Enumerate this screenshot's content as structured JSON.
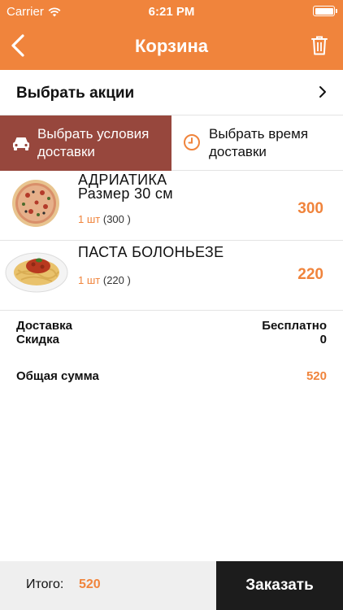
{
  "status_bar": {
    "carrier": "Carrier",
    "time": "6:21 PM"
  },
  "nav": {
    "title": "Корзина",
    "back_icon": "chevron-left-icon",
    "trash_icon": "trash-icon"
  },
  "promotions": {
    "label": "Выбрать акции",
    "chevron_icon": "chevron-right-icon"
  },
  "delivery_options": {
    "conditions": {
      "label": "Выбрать условия доставки",
      "icon": "car-icon"
    },
    "time": {
      "label": "Выбрать время доставки",
      "icon": "clock-icon"
    }
  },
  "cart_items": [
    {
      "name": "АДРИАТИКА",
      "size": "Размер 30 см",
      "qty": "1 шт",
      "qty_detail": "(300 )",
      "price": "300",
      "image": "pizza-image"
    },
    {
      "name": "ПАСТА БОЛОНЬЕЗЕ",
      "size": "",
      "qty": "1 шт",
      "qty_detail": "(220 )",
      "price": "220",
      "image": "pasta-image"
    }
  ],
  "summary": {
    "delivery_label": "Доставка",
    "delivery_value": "Бесплатно",
    "discount_label": "Скидка",
    "discount_value": "0",
    "total_label": "Общая сумма",
    "total_value": "520"
  },
  "footer": {
    "total_label": "Итого:",
    "total_value": "520",
    "order_button": "Заказать"
  },
  "colors": {
    "accent": "#f0843c",
    "selected_option": "#97473d",
    "order_button": "#1c1c1c"
  }
}
